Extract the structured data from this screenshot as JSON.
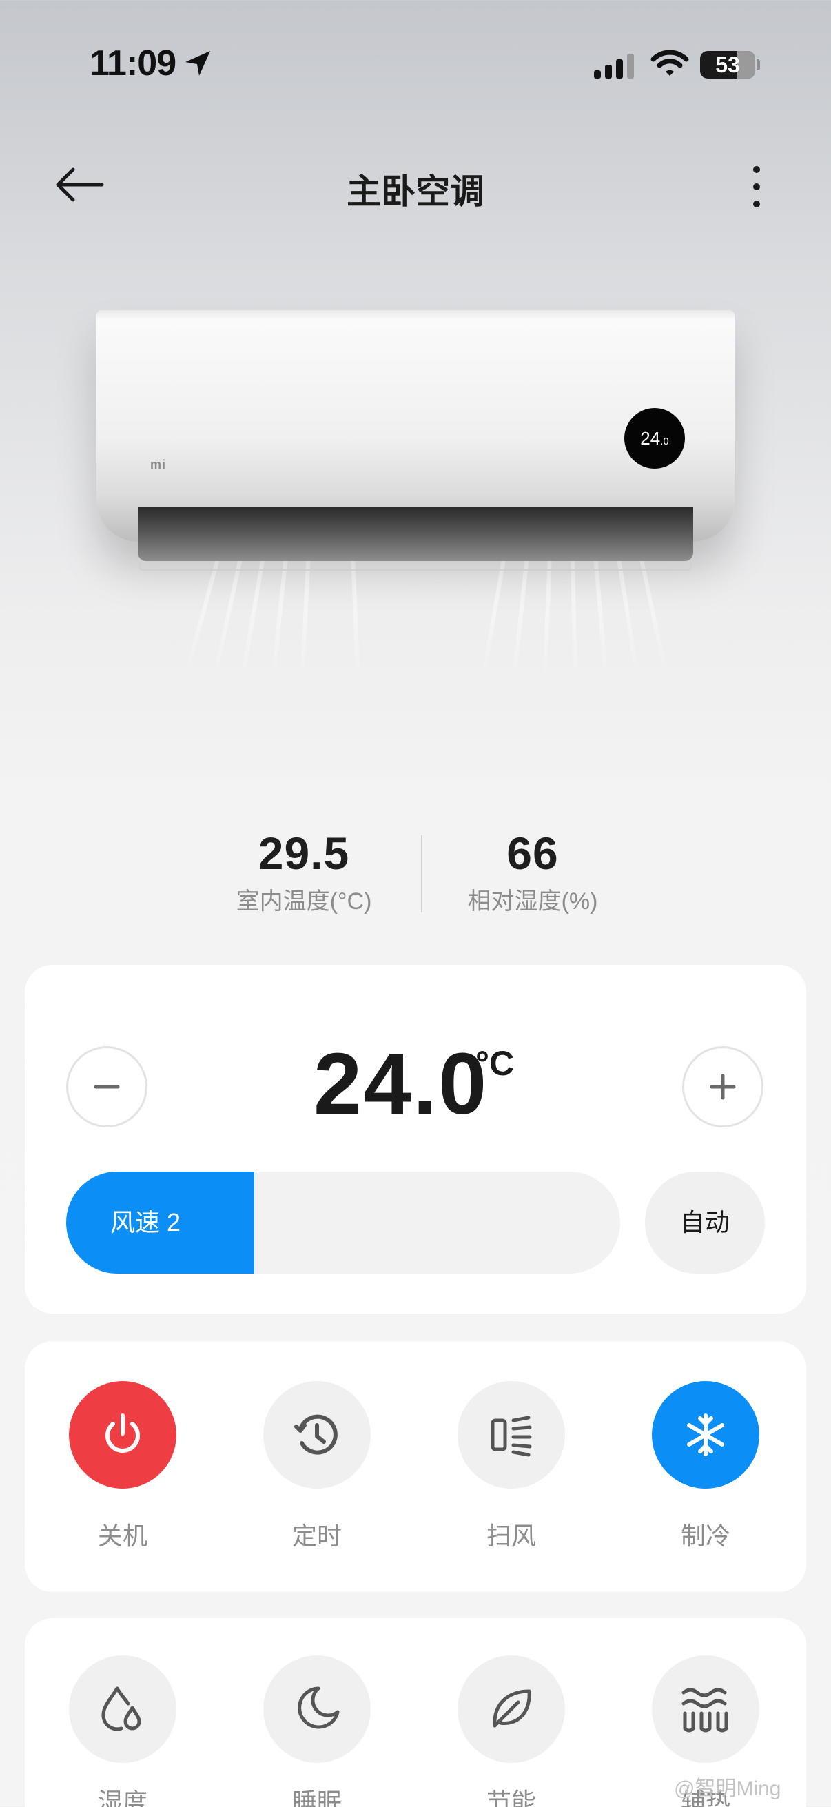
{
  "status_bar": {
    "time": "11:09",
    "battery": "53"
  },
  "header": {
    "title": "主卧空调"
  },
  "device_image": {
    "display_value": "24",
    "display_decimal": ".0",
    "brand_mark": "mi"
  },
  "readings": [
    {
      "value": "29.5",
      "label": "室内温度(°C)"
    },
    {
      "value": "66",
      "label": "相对湿度(%)"
    }
  ],
  "temperature": {
    "setpoint": "24.0",
    "unit": "°C"
  },
  "fan": {
    "label": "风速 2",
    "level_fraction": 0.34,
    "auto_label": "自动"
  },
  "modes": [
    {
      "label": "关机",
      "icon": "power-icon",
      "bg": "#ee3e43",
      "fg": "#ffffff"
    },
    {
      "label": "定时",
      "icon": "timer-icon",
      "bg": "#f0f0f0",
      "fg": "#555555"
    },
    {
      "label": "扫风",
      "icon": "swing-icon",
      "bg": "#f0f0f0",
      "fg": "#555555"
    },
    {
      "label": "制冷",
      "icon": "snowflake-icon",
      "bg": "#0b8ff6",
      "fg": "#ffffff"
    }
  ],
  "functions": [
    {
      "label": "湿度",
      "icon": "droplet-icon"
    },
    {
      "label": "睡眠",
      "icon": "moon-icon"
    },
    {
      "label": "节能",
      "icon": "leaf-icon"
    },
    {
      "label": "辅热",
      "icon": "heat-waves-icon"
    }
  ],
  "watermark": "@智明Ming"
}
